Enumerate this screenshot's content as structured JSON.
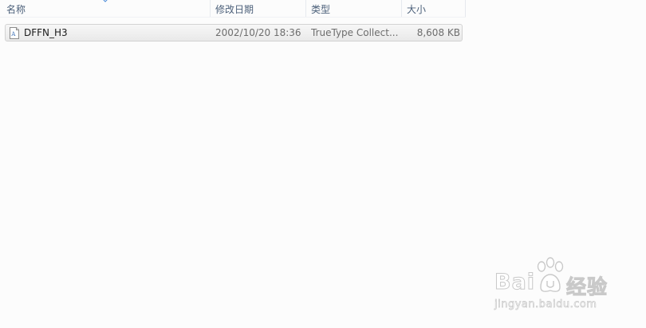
{
  "columns": {
    "name": "名称",
    "date": "修改日期",
    "type": "类型",
    "size": "大小"
  },
  "files": [
    {
      "name": "DFFN_H3",
      "date": "2002/10/20 18:36",
      "type": "TrueType Collect...",
      "size": "8,608 KB",
      "icon": "font-file-icon"
    }
  ],
  "watermark": {
    "brand_left": "Bai",
    "brand_right": "经验",
    "url": "jingyan.baidu.com"
  }
}
